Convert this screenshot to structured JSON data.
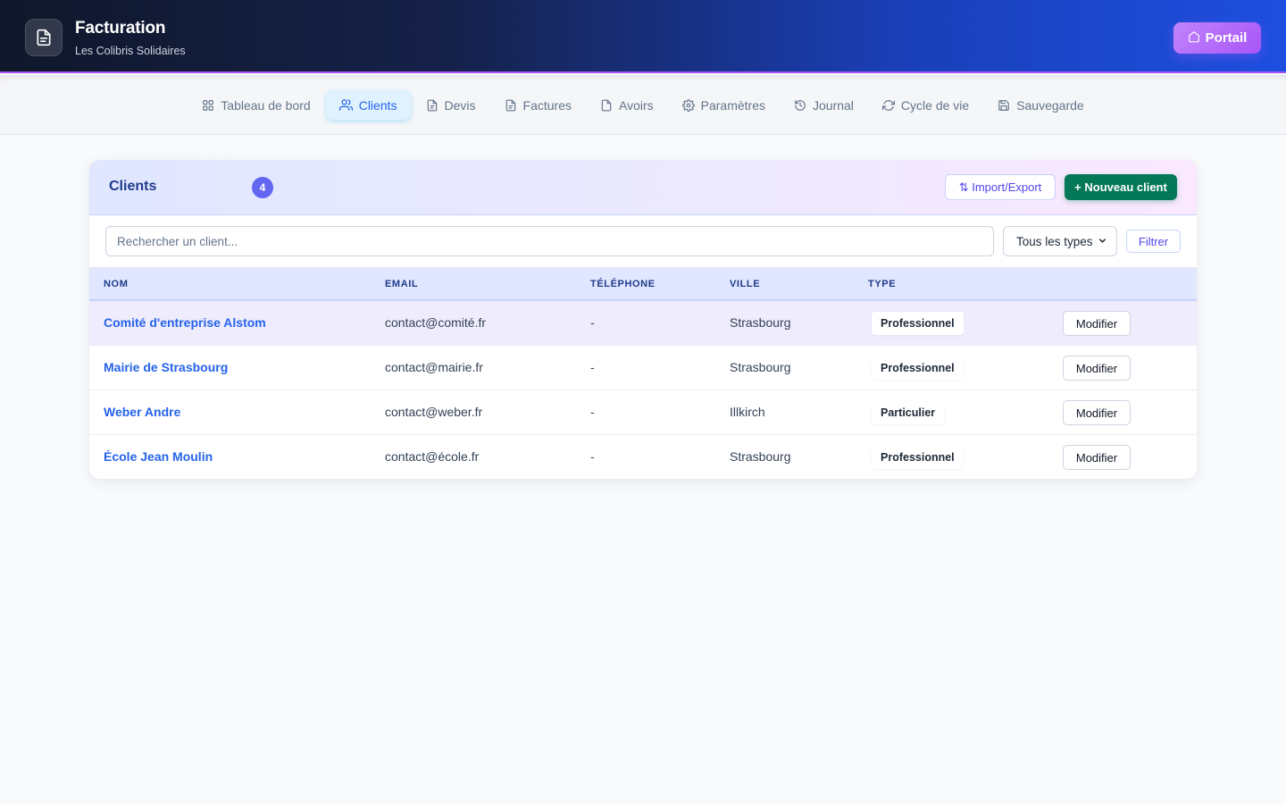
{
  "header": {
    "title": "Facturation",
    "subtitle": "Les Colibris Solidaires",
    "logo_icon": "document-icon",
    "portal_button": {
      "label": "Portail",
      "icon": "home-icon"
    }
  },
  "nav": {
    "items": [
      {
        "label": "Tableau de bord",
        "icon": "dashboard-icon",
        "active": false
      },
      {
        "label": "Clients",
        "icon": "users-icon",
        "active": true
      },
      {
        "label": "Devis",
        "icon": "document-icon",
        "active": false
      },
      {
        "label": "Factures",
        "icon": "document-icon",
        "active": false
      },
      {
        "label": "Avoirs",
        "icon": "document-icon",
        "active": false
      },
      {
        "label": "Paramètres",
        "icon": "gear-icon",
        "active": false
      },
      {
        "label": "Journal",
        "icon": "history-icon",
        "active": false
      },
      {
        "label": "Cycle de vie",
        "icon": "refresh-icon",
        "active": false
      },
      {
        "label": "Sauvegarde",
        "icon": "save-icon",
        "active": false
      }
    ]
  },
  "clients_card": {
    "title": "Clients",
    "count": "4",
    "import_export_label": "⇅ Import/Export",
    "new_client_label": "+ Nouveau client",
    "search_placeholder": "Rechercher un client...",
    "type_filter_value": "Tous les types",
    "filter_button_label": "Filtrer",
    "columns": {
      "name": "NOM",
      "email": "EMAIL",
      "phone": "TÉLÉPHONE",
      "city": "VILLE",
      "type": "TYPE"
    },
    "rows": [
      {
        "name": "Comité d'entreprise Alstom",
        "email": "contact@comité.fr",
        "phone": "-",
        "city": "Strasbourg",
        "type": "Professionnel",
        "action": "Modifier"
      },
      {
        "name": "Mairie de Strasbourg",
        "email": "contact@mairie.fr",
        "phone": "-",
        "city": "Strasbourg",
        "type": "Professionnel",
        "action": "Modifier"
      },
      {
        "name": "Weber Andre",
        "email": "contact@weber.fr",
        "phone": "-",
        "city": "Illkirch",
        "type": "Particulier",
        "action": "Modifier"
      },
      {
        "name": "École Jean Moulin",
        "email": "contact@école.fr",
        "phone": "-",
        "city": "Strasbourg",
        "type": "Professionnel",
        "action": "Modifier"
      }
    ]
  },
  "colors": {
    "accent": "#2563eb",
    "primary_action": "#047857",
    "portal": "#a855f7",
    "badge": "#6366f1"
  }
}
